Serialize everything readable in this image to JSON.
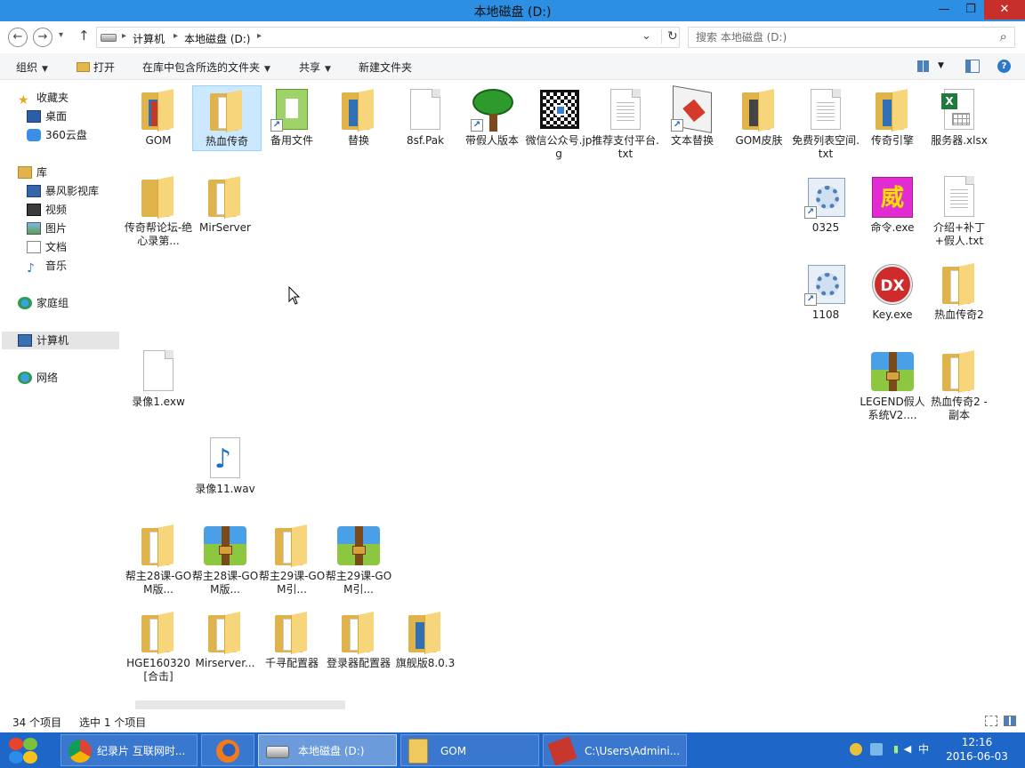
{
  "window": {
    "title": "本地磁盘 (D:)",
    "minimize_glyph": "—",
    "maximize_glyph": "❐",
    "close_glyph": "✕"
  },
  "address": {
    "back_glyph": "←",
    "forward_glyph": "→",
    "history_glyph": "▾",
    "up_glyph": "↑",
    "crumbs": [
      "计算机",
      "本地磁盘 (D:)"
    ],
    "separator": "▸",
    "dropdown_glyph": "⌄",
    "refresh_glyph": "↻",
    "search_placeholder": "搜索 本地磁盘 (D:)",
    "search_glyph": "⌕"
  },
  "commands": {
    "organize": "组织",
    "open": "打开",
    "include_in_library": "在库中包含所选的文件夹",
    "share": "共享",
    "new_folder": "新建文件夹",
    "caret": "▼",
    "help_glyph": "?"
  },
  "nav": {
    "favorites": "收藏夹",
    "desktop": "桌面",
    "cloud": "360云盘",
    "libraries": "库",
    "baofeng": "暴风影视库",
    "videos": "视频",
    "pictures": "图片",
    "documents": "文档",
    "music": "音乐",
    "homegroup": "家庭组",
    "computer": "计算机",
    "network": "网络"
  },
  "files": [
    {
      "label": "GOM",
      "type": "folder-tag"
    },
    {
      "label": "热血传奇",
      "type": "folder"
    },
    {
      "label": "备用文件",
      "type": "greendoc"
    },
    {
      "label": "替换",
      "type": "folder-tag"
    },
    {
      "label": "8sf.Pak",
      "type": "doc"
    },
    {
      "label": "带假人版本",
      "type": "tree"
    },
    {
      "label": "微信公众号.jpg",
      "type": "qr"
    },
    {
      "label": "推荐支付平台.txt",
      "type": "txt"
    },
    {
      "label": "文本替换",
      "type": "textsw"
    },
    {
      "label": "GOM皮肤",
      "type": "folder-dark"
    },
    {
      "label": "免费列表空间.txt",
      "type": "txt"
    },
    {
      "label": "传奇引擎",
      "type": "folder-tag"
    },
    {
      "label": "服务器.xlsx",
      "type": "excel"
    },
    {
      "label": "传奇帮论坛-绝心录第...",
      "type": "folder"
    },
    {
      "label": "MirServer",
      "type": "folder"
    },
    {
      "label": "0325",
      "type": "gear"
    },
    {
      "label": "命令.exe",
      "type": "wei"
    },
    {
      "label": "介绍+补丁+假人.txt",
      "type": "txt"
    },
    {
      "label": "1108",
      "type": "gear"
    },
    {
      "label": "Key.exe",
      "type": "dx"
    },
    {
      "label": "热血传奇2",
      "type": "folder"
    },
    {
      "label": "录像1.exw",
      "type": "doc"
    },
    {
      "label": "LEGEND假人系统V2....",
      "type": "winrar"
    },
    {
      "label": "热血传奇2 - 副本",
      "type": "folder"
    },
    {
      "label": "录像11.wav",
      "type": "music"
    },
    {
      "label": "帮主28课-GOM版...",
      "type": "folder"
    },
    {
      "label": "帮主28课-GOM版...",
      "type": "winrar"
    },
    {
      "label": "帮主29课-GOM引...",
      "type": "folder"
    },
    {
      "label": "帮主29课-GOM引...",
      "type": "winrar"
    },
    {
      "label": "HGE160320[合击]",
      "type": "folder"
    },
    {
      "label": "Mirserver...",
      "type": "folder"
    },
    {
      "label": "千寻配置器",
      "type": "folder"
    },
    {
      "label": "登录器配置器",
      "type": "folder"
    },
    {
      "label": "旗舰版8.0.3",
      "type": "folder-tag"
    }
  ],
  "status": {
    "item_count": "34 个项目",
    "selected": "选中 1 个项目"
  },
  "taskbar": {
    "chrome": "纪录片 互联网时...",
    "explorer": "本地磁盘 (D:)",
    "gom": "GOM",
    "cmd": "C:\\Users\\Admini...",
    "ime": "中",
    "time": "12:16",
    "date": "2016-06-03"
  }
}
